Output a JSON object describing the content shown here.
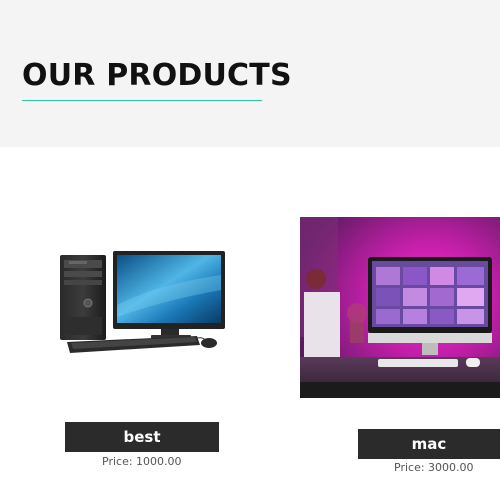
{
  "section": {
    "title": "OUR PRODUCTS",
    "accent_color": "#2ec4a6"
  },
  "products": [
    {
      "name": "best",
      "price": "Price: 1000.00",
      "image": "desktop-computer-image"
    },
    {
      "name": "mac",
      "price": "Price: 3000.00",
      "image": "imac-desk-setup-image"
    }
  ]
}
